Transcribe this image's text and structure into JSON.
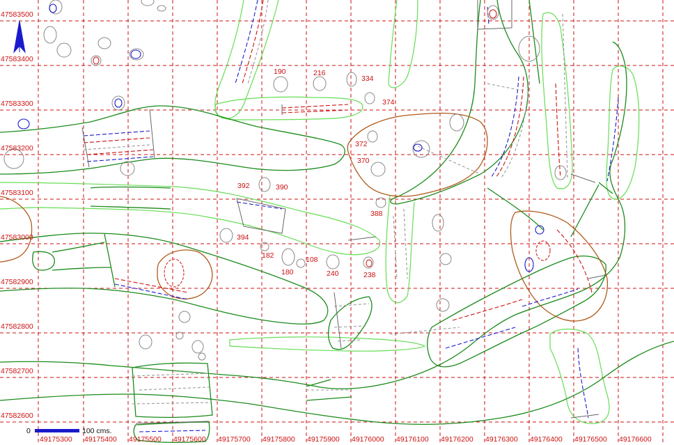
{
  "map": {
    "north_arrow": "north-arrow",
    "grid": true,
    "y_axis_labels": [
      "47583500",
      "47583400",
      "47583300",
      "47583200",
      "47583100",
      "47583000",
      "47582900",
      "47582800",
      "47582700",
      "47582600"
    ],
    "x_axis_labels": [
      "49175300",
      "49175400",
      "49175500",
      "49175600",
      "49175700",
      "49175800",
      "49175900",
      "49176000",
      "49176100",
      "49176200",
      "49176300",
      "49176400",
      "49176500",
      "49176600"
    ],
    "feature_labels": [
      "190",
      "216",
      "334",
      "374",
      "372",
      "370",
      "392",
      "390",
      "388",
      "394",
      "182",
      "108",
      "180",
      "240",
      "238"
    ],
    "scale_bar": {
      "start": "0",
      "end": "100 cms."
    },
    "colors": {
      "grid": "#cc1111",
      "outline_dark": "#1a8a1a",
      "outline_light": "#66dd55",
      "brown": "#b05a1a",
      "feature": "#888888",
      "blue": "#1a1acc",
      "label": "#cc1111"
    }
  }
}
